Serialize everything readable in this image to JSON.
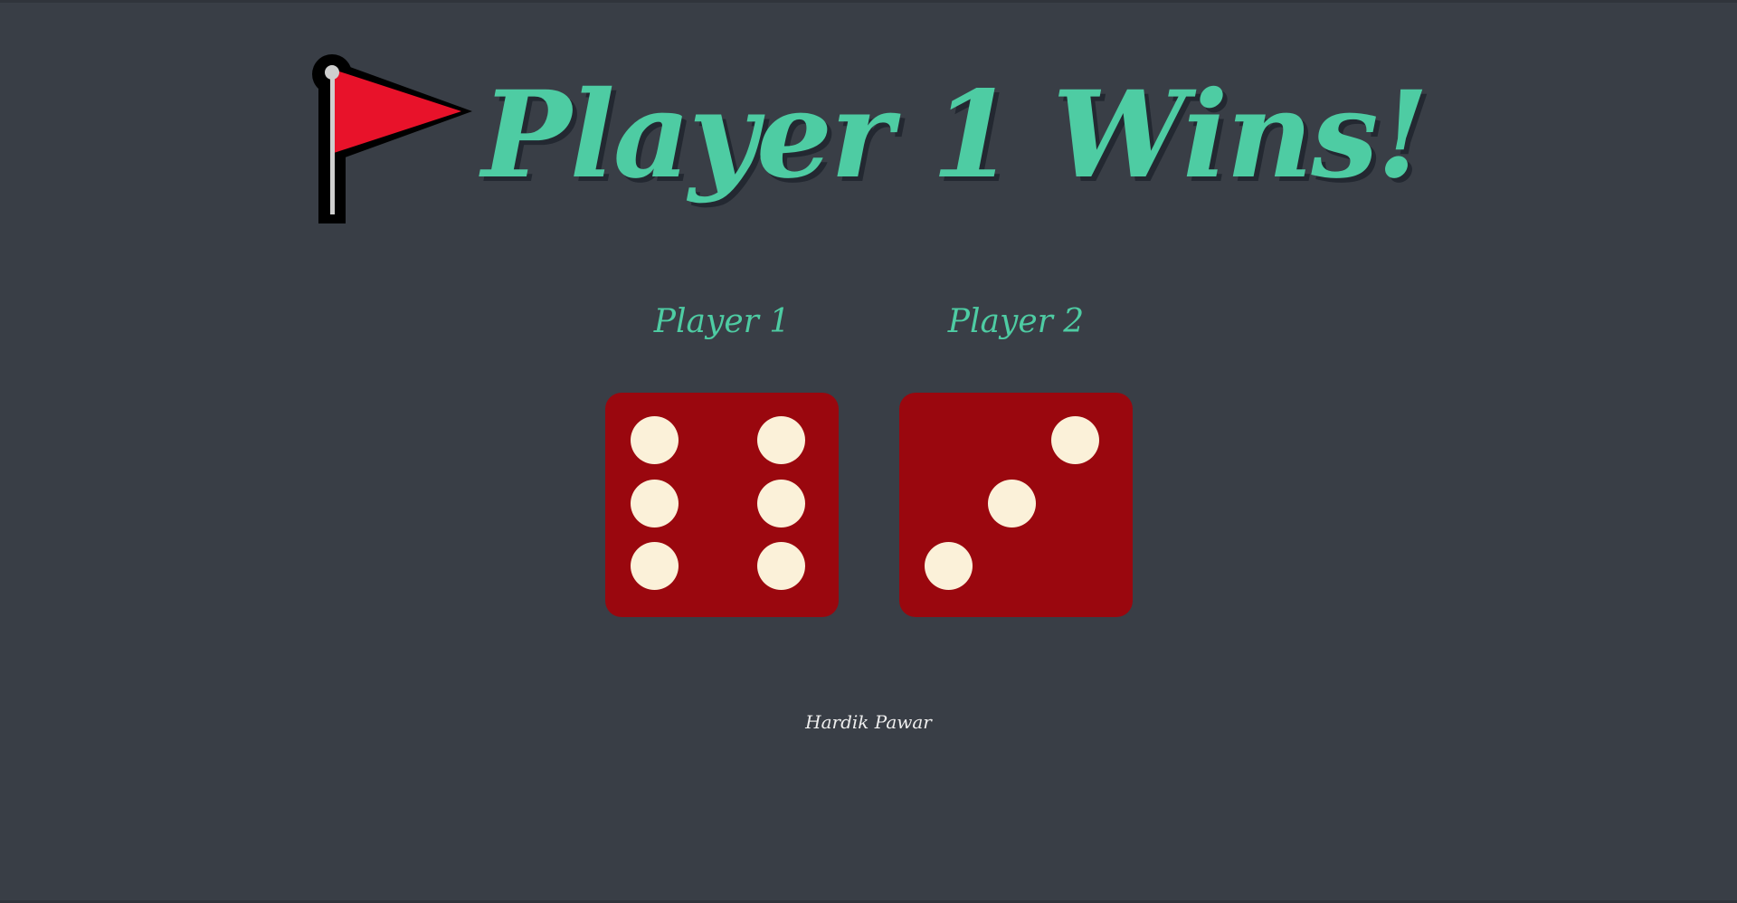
{
  "header": {
    "title": "Player 1 Wins!",
    "icon": "red-flag-icon"
  },
  "players": [
    {
      "label": "Player 1",
      "dice_value": 6
    },
    {
      "label": "Player 2",
      "dice_value": 3
    }
  ],
  "footer": {
    "credit": "Hardik Pawar"
  },
  "colors": {
    "background": "#393e46",
    "accent": "#4ecca3",
    "die": "#9a070e",
    "pip": "#fbf1d9",
    "flag": "#e8122a"
  }
}
